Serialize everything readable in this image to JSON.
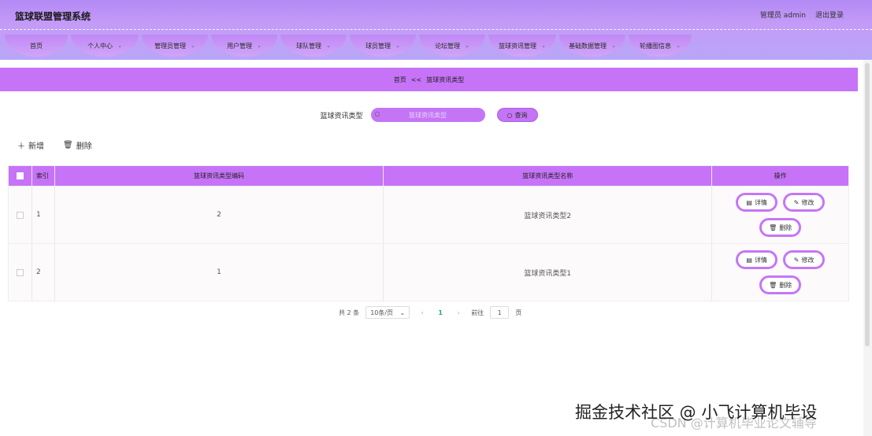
{
  "header": {
    "title": "篮球联盟管理系统",
    "user_label": "管理员 admin",
    "logout": "退出登录"
  },
  "nav": [
    {
      "label": "首页",
      "chevron": false
    },
    {
      "label": "个人中心",
      "chevron": true
    },
    {
      "label": "管理员管理",
      "chevron": true
    },
    {
      "label": "用户管理",
      "chevron": true
    },
    {
      "label": "球队管理",
      "chevron": true
    },
    {
      "label": "球员管理",
      "chevron": true
    },
    {
      "label": "论坛管理",
      "chevron": true
    },
    {
      "label": "篮球资讯管理",
      "chevron": true
    },
    {
      "label": "基础数据管理",
      "chevron": true
    },
    {
      "label": "轮播图信息",
      "chevron": true
    }
  ],
  "breadcrumb": {
    "home": "首页",
    "sep": "<<",
    "current": "篮球资讯类型"
  },
  "search": {
    "label": "篮球资讯类型",
    "placeholder": "篮球资讯类型",
    "button": "查询"
  },
  "actions": {
    "add": "新增",
    "delete": "删除"
  },
  "table": {
    "columns": [
      "索引",
      "篮球资讯类型编码",
      "篮球资讯类型名称",
      "操作"
    ],
    "rows": [
      {
        "index": "1",
        "code": "2",
        "name": "篮球资讯类型2"
      },
      {
        "index": "2",
        "code": "1",
        "name": "篮球资讯类型1"
      }
    ],
    "ops": {
      "detail": "详情",
      "edit": "修改",
      "delete": "删除"
    }
  },
  "pager": {
    "total": "共 2 条",
    "size": "10条/页",
    "current": "1",
    "goto_label": "前往",
    "goto_value": "1",
    "page_suffix": "页"
  },
  "watermark": {
    "main": "掘金技术社区 @ 小飞计算机毕设",
    "sub": "CSDN @计算机毕业论文辅导"
  },
  "colors": {
    "accent": "#c673f7",
    "button_border": "#c576f6",
    "page_current": "#2aa086"
  }
}
